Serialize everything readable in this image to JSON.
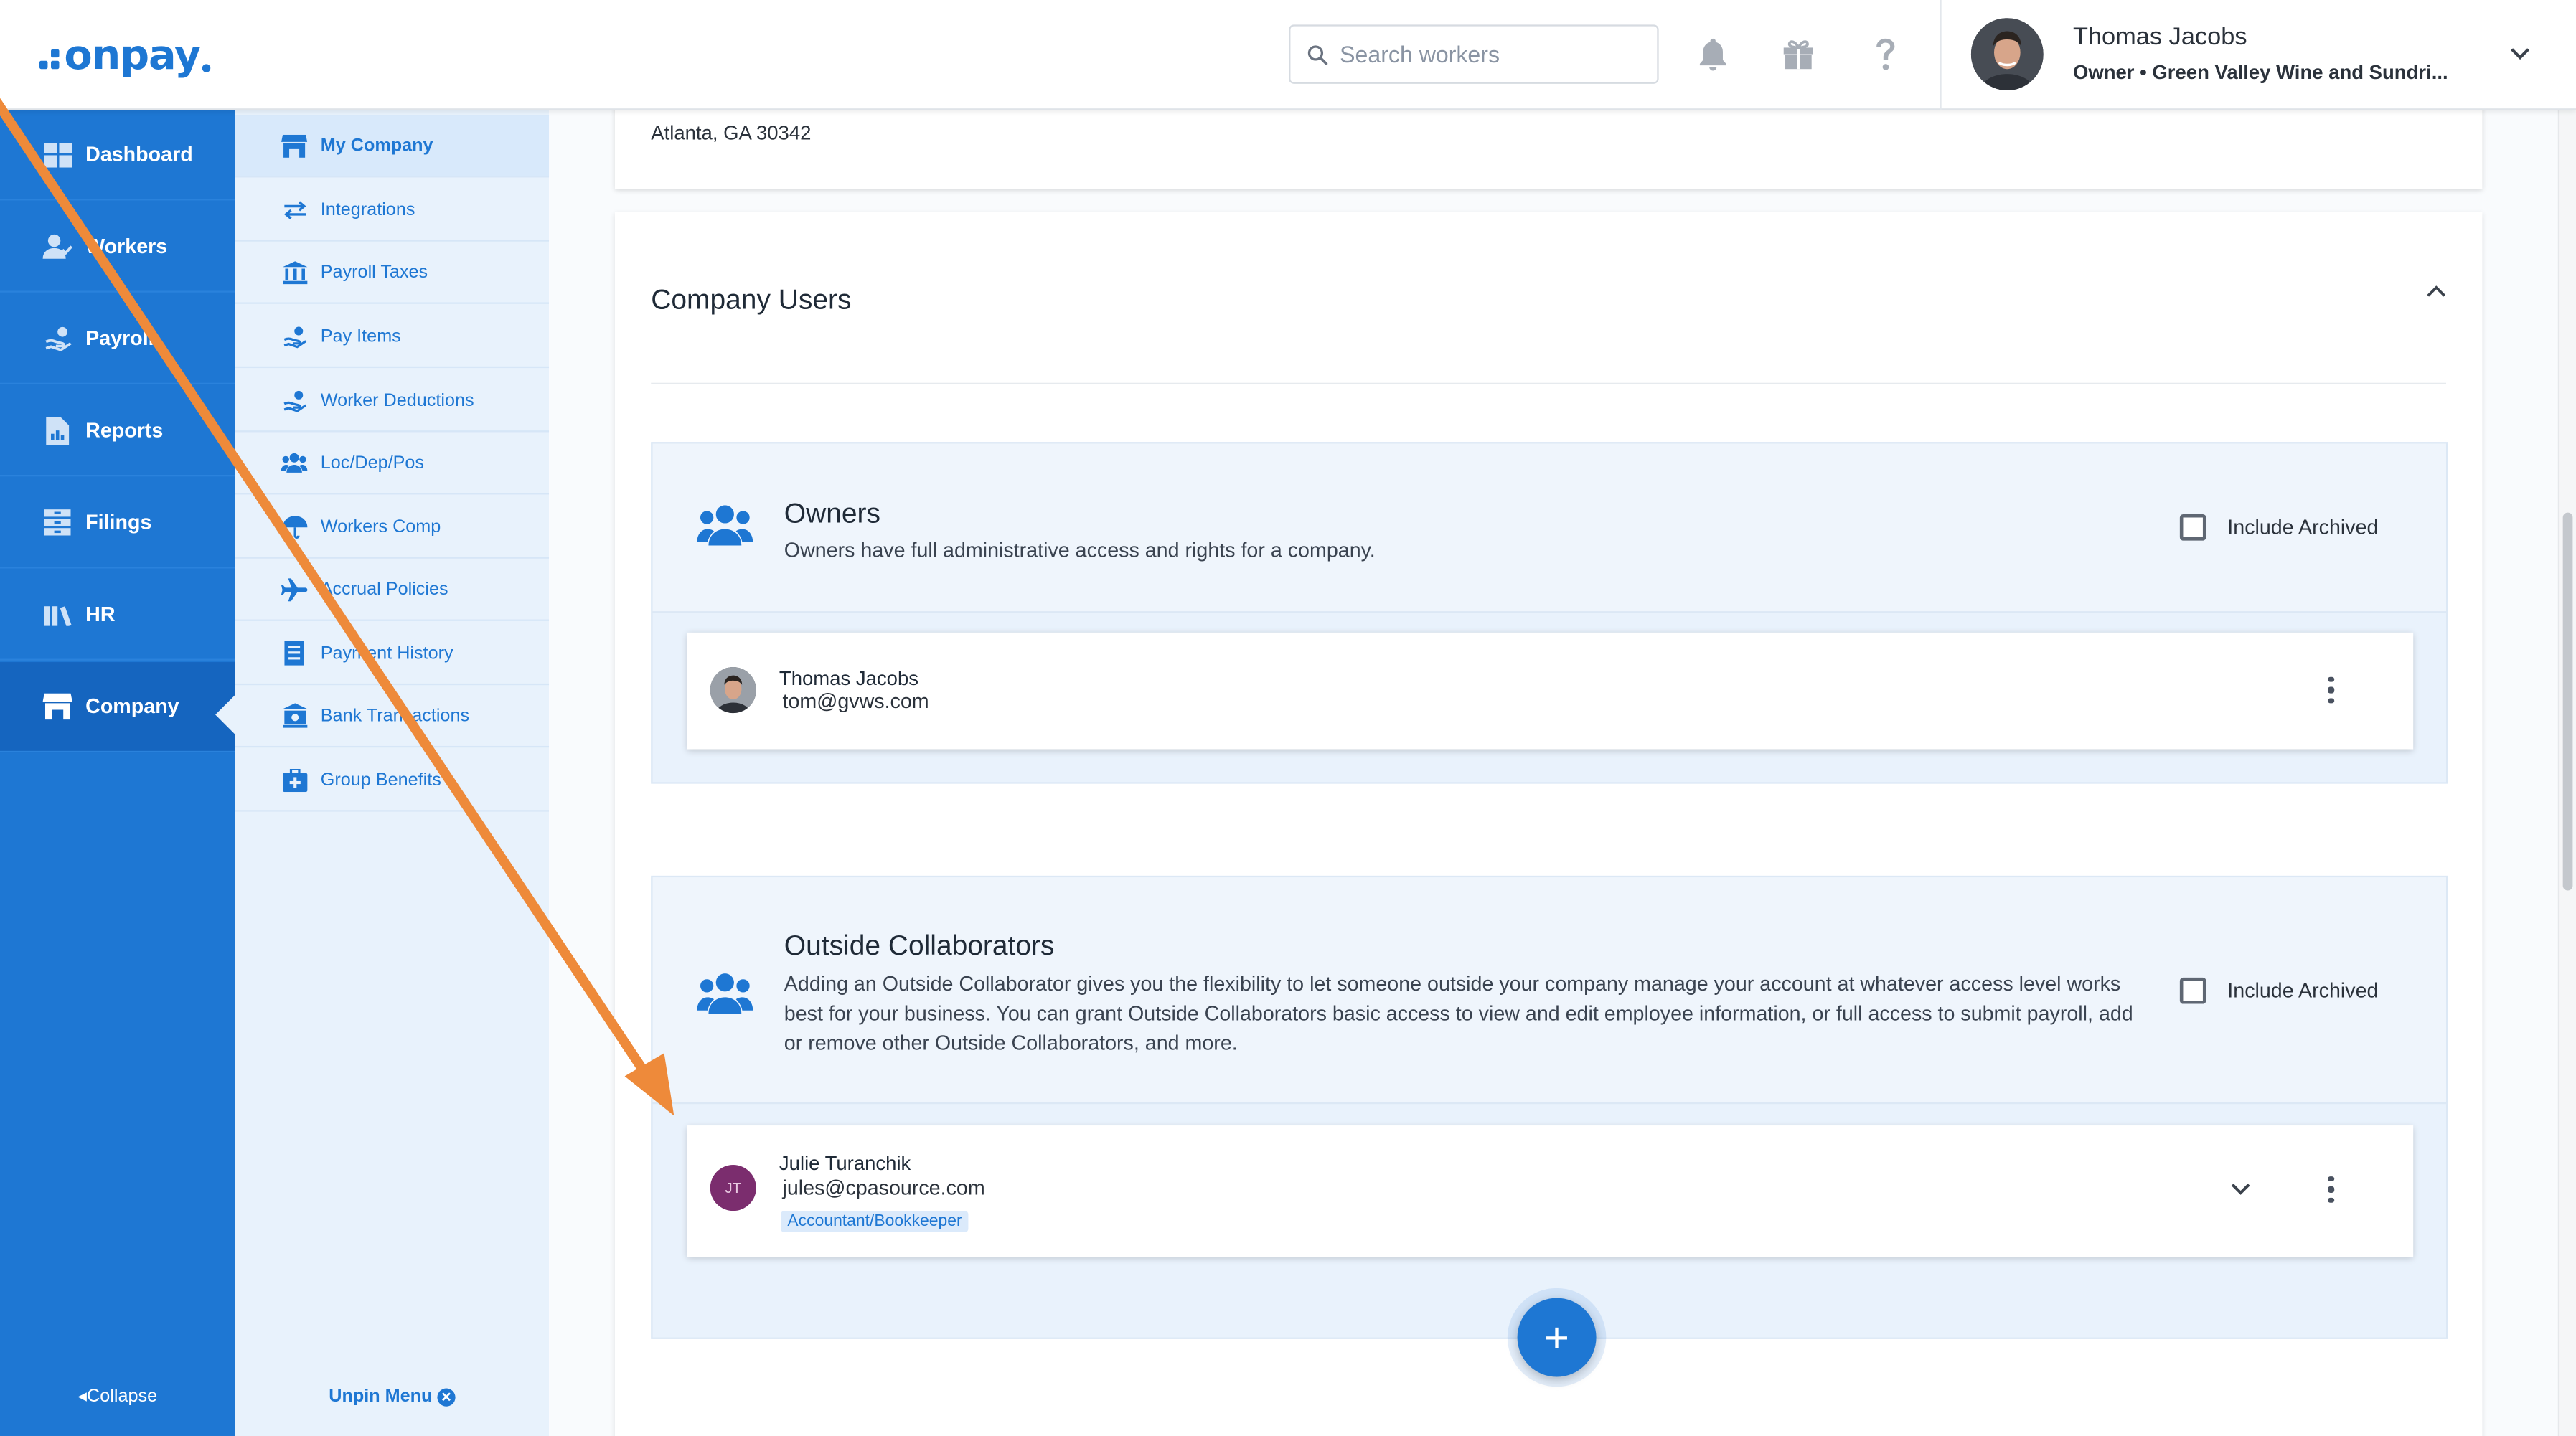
{
  "app": {
    "logo_text": "onpay",
    "brand_color": "#1e77d3"
  },
  "header": {
    "search_placeholder": "Search workers",
    "user_name": "Thomas Jacobs",
    "user_role_company": "Owner • Green Valley Wine and Sundri..."
  },
  "sidebar": {
    "items": [
      {
        "label": "Dashboard",
        "icon": "dashboard-icon"
      },
      {
        "label": "Workers",
        "icon": "workers-icon"
      },
      {
        "label": "Payroll",
        "icon": "payroll-icon"
      },
      {
        "label": "Reports",
        "icon": "reports-icon"
      },
      {
        "label": "Filings",
        "icon": "filings-icon"
      },
      {
        "label": "HR",
        "icon": "hr-icon"
      },
      {
        "label": "Company",
        "icon": "company-icon",
        "active": true
      }
    ],
    "collapse_label": "Collapse"
  },
  "subnav": {
    "items": [
      {
        "label": "My Company",
        "icon": "store-icon",
        "active": true
      },
      {
        "label": "Integrations",
        "icon": "arrows-icon"
      },
      {
        "label": "Payroll Taxes",
        "icon": "bank-icon"
      },
      {
        "label": "Pay Items",
        "icon": "hand-money-icon"
      },
      {
        "label": "Worker Deductions",
        "icon": "hand-money-icon"
      },
      {
        "label": "Loc/Dep/Pos",
        "icon": "users-icon"
      },
      {
        "label": "Workers Comp",
        "icon": "umbrella-icon"
      },
      {
        "label": "Accrual Policies",
        "icon": "plane-icon"
      },
      {
        "label": "Payment History",
        "icon": "receipt-icon"
      },
      {
        "label": "Bank Transactions",
        "icon": "bank-building-icon"
      },
      {
        "label": "Group Benefits",
        "icon": "medical-kit-icon"
      }
    ],
    "unpin_label": "Unpin Menu"
  },
  "main": {
    "address_line": "Atlanta, GA 30342",
    "company_users_title": "Company Users",
    "owners": {
      "title": "Owners",
      "description": "Owners have full administrative access and rights for a company.",
      "include_archived_label": "Include Archived",
      "users": [
        {
          "name": "Thomas Jacobs",
          "email": "tom@gvws.com"
        }
      ]
    },
    "collaborators": {
      "title": "Outside Collaborators",
      "description": "Adding an Outside Collaborator gives you the flexibility to let someone outside your company manage your account at whatever access level works best for your business. You can grant Outside Collaborators basic access to view and edit employee information, or full access to submit payroll, add or remove other Outside Collaborators, and more.",
      "include_archived_label": "Include Archived",
      "users": [
        {
          "name": "Julie Turanchik",
          "email": "jules@cpasource.com",
          "initials": "JT",
          "role_badge": "Accountant/Bookkeeper",
          "avatar_color": "#7b2d6e"
        }
      ]
    },
    "add_button_label": "+"
  },
  "annotation": {
    "arrow_color": "#ee8a3a"
  }
}
